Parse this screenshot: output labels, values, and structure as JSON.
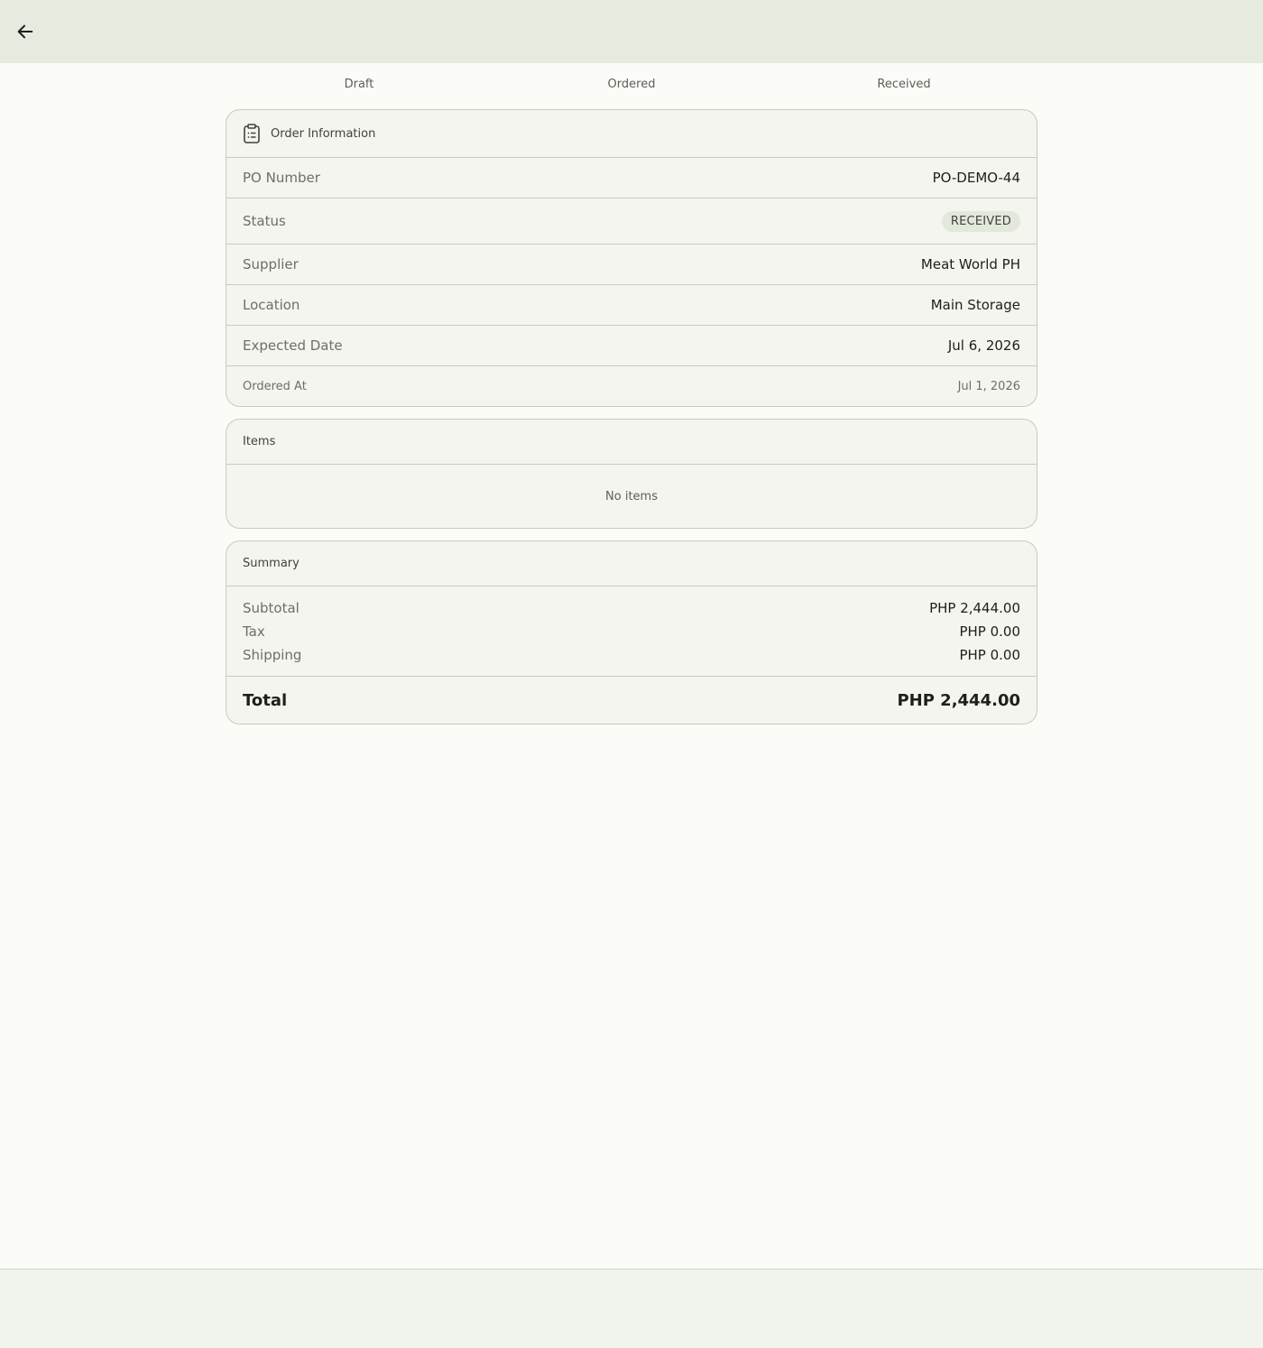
{
  "stepper": {
    "steps": [
      "Draft",
      "Ordered",
      "Received"
    ]
  },
  "order_info": {
    "title": "Order Information",
    "po_number": {
      "label": "PO Number",
      "value": "PO-DEMO-44"
    },
    "status": {
      "label": "Status",
      "value": "RECEIVED"
    },
    "supplier": {
      "label": "Supplier",
      "value": "Meat World PH"
    },
    "location": {
      "label": "Location",
      "value": "Main Storage"
    },
    "expected_date": {
      "label": "Expected Date",
      "value": "Jul 6, 2026"
    },
    "ordered_at": {
      "label": "Ordered At",
      "value": "Jul 1, 2026"
    }
  },
  "items": {
    "title": "Items",
    "empty_text": "No items"
  },
  "summary": {
    "title": "Summary",
    "subtotal": {
      "label": "Subtotal",
      "value": "PHP 2,444.00"
    },
    "tax": {
      "label": "Tax",
      "value": "PHP 0.00"
    },
    "shipping": {
      "label": "Shipping",
      "value": "PHP 0.00"
    },
    "total": {
      "label": "Total",
      "value": "PHP 2,444.00"
    }
  },
  "icons": {
    "back": "arrow-left-icon",
    "order_info": "clipboard-list-icon"
  }
}
